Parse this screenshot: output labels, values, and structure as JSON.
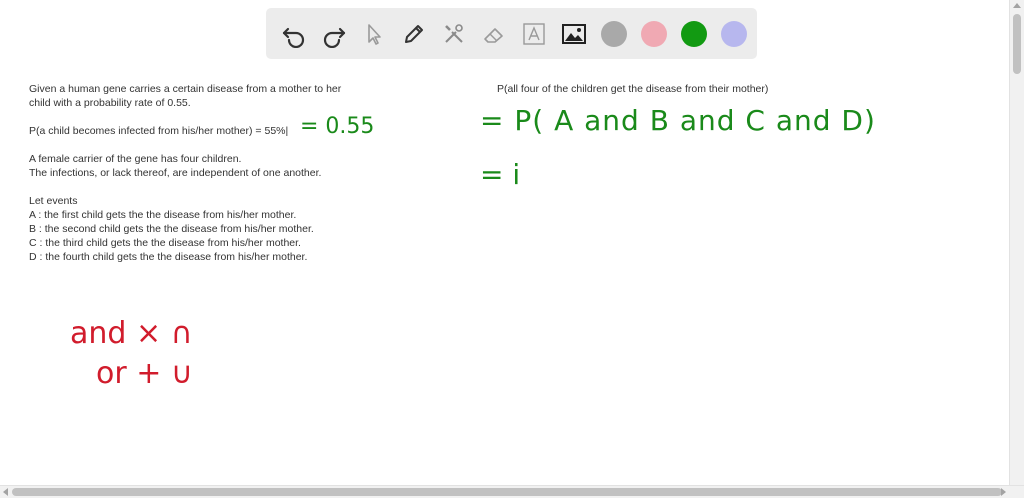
{
  "toolbar": {
    "tools": [
      {
        "name": "undo-icon"
      },
      {
        "name": "redo-icon"
      },
      {
        "name": "pointer-icon"
      },
      {
        "name": "pen-icon"
      },
      {
        "name": "tools-icon"
      },
      {
        "name": "eraser-icon"
      },
      {
        "name": "text-box-icon"
      },
      {
        "name": "image-icon"
      }
    ],
    "colors": [
      "#a9a9a9",
      "#f0a9b3",
      "#129a12",
      "#b7b7ee"
    ]
  },
  "problem": {
    "line1": "Given a human gene carries a certain disease from a mother to her",
    "line2": "child with a probability rate of 0.55.",
    "prob_line": "P(a child becomes infected from his/her mother) = 55%|",
    "carrier1": "A female carrier of the gene has four children.",
    "carrier2": "The infections, or lack thereof, are independent of one another.",
    "events_title": "Let events",
    "event_a": "A : the first child gets the the disease from his/her mother.",
    "event_b": "B : the second child gets the the disease from his/her mother.",
    "event_c": "C : the third child gets the the disease from his/her mother.",
    "event_d": "D : the fourth child gets the the disease from his/her mother."
  },
  "right": {
    "header": "P(all four of the children get the disease from their mother)"
  },
  "handwriting": {
    "eq_value": "= 0.55",
    "eq_p": "= P( A and B  and C  and D)",
    "eq_next": "= i",
    "and_line": "and × ∩",
    "or_line": "or + ∪"
  }
}
